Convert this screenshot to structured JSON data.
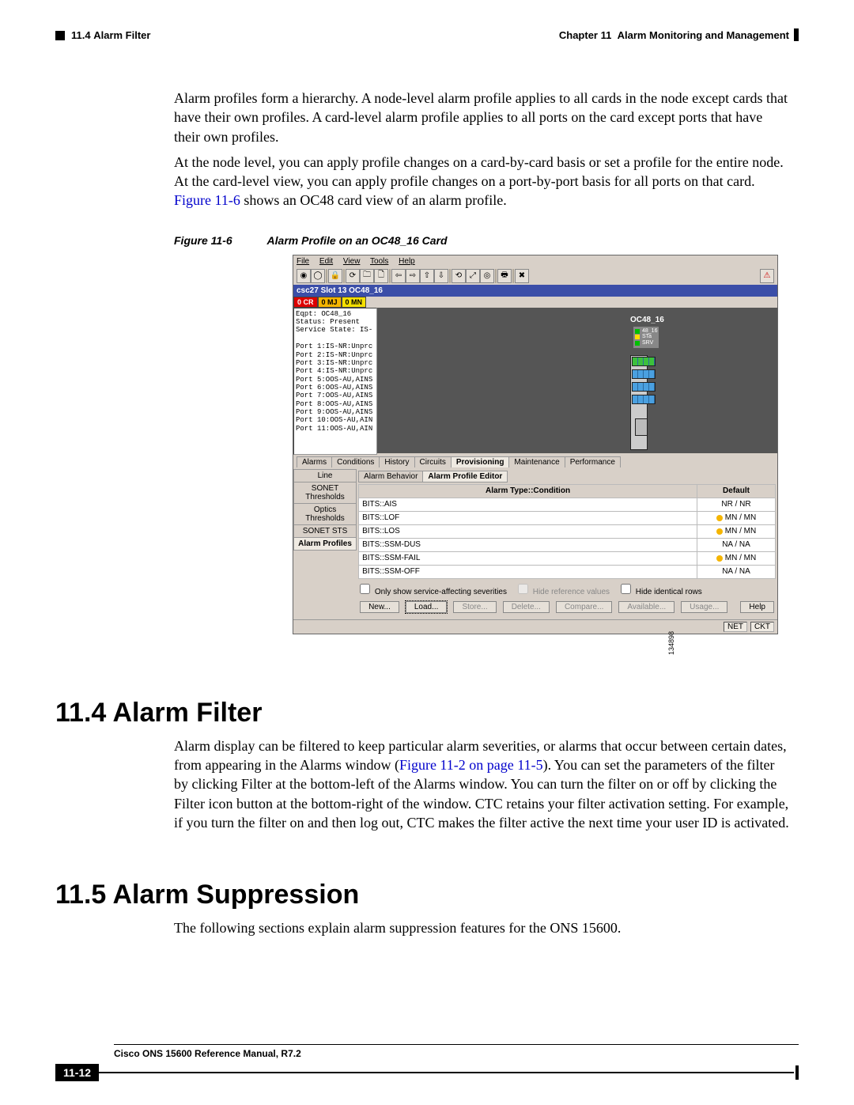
{
  "header": {
    "section_ref": "11.4",
    "section_title_small": "Alarm Filter",
    "chapter_label": "Chapter 11",
    "chapter_title": "Alarm Monitoring and Management"
  },
  "para1": "Alarm profiles form a hierarchy. A node-level alarm profile applies to all cards in the node except cards that have their own profiles. A card-level alarm profile applies to all ports on the card except ports that have their own profiles.",
  "para2a": "At the node level, you can apply profile changes on a card-by-card basis or set a profile for the entire node. At the card-level view, you can apply profile changes on a port-by-port basis for all ports on that card. ",
  "para2_link": "Figure 11-6",
  "para2b": " shows an OC48 card view of an alarm profile.",
  "figure": {
    "label": "Figure 11-6",
    "title": "Alarm Profile on an OC48_16 Card"
  },
  "shot": {
    "menus": [
      "File",
      "Edit",
      "View",
      "Tools",
      "Help"
    ],
    "title": "csc27 Slot 13 OC48_16",
    "counts": {
      "cr": "0 CR",
      "mj": "0 MJ",
      "mn": "0 MN"
    },
    "status_lines": [
      "Eqpt: OC48_16",
      "Status: Present",
      "Service State: IS-",
      "",
      "Port 1:IS-NR:Unprc",
      "Port 2:IS-NR:Unprc",
      "Port 3:IS-NR:Unprc",
      "Port 4:IS-NR:Unprc",
      "Port 5:OOS-AU,AINS",
      "Port 6:OOS-AU,AINS",
      "Port 7:OOS-AU,AINS",
      "Port 8:OOS-AU,AINS",
      "Port 9:OOS-AU,AINS",
      "Port 10:OOS-AU,AIN",
      "Port 11:OOS-AU,AIN"
    ],
    "card_label": "OC48_16",
    "legend": [
      {
        "color": "#00c000",
        "label": "48_16"
      },
      {
        "color": "#ffe000",
        "label": "STa"
      },
      {
        "color": "#00c000",
        "label": "SRV"
      }
    ],
    "top_tabs": [
      "Alarms",
      "Conditions",
      "History",
      "Circuits",
      "Provisioning",
      "Maintenance",
      "Performance"
    ],
    "top_tab_active": "Provisioning",
    "side_tabs": [
      "Line",
      "SONET Thresholds",
      "Optics Thresholds",
      "SONET STS",
      "Alarm Profiles"
    ],
    "side_tab_active": "Alarm Profiles",
    "sub_tabs": [
      "Alarm Behavior",
      "Alarm Profile Editor"
    ],
    "sub_tab_active": "Alarm Profile Editor",
    "grid_headers": [
      "Alarm Type::Condition",
      "Default"
    ],
    "grid_rows": [
      {
        "cond": "BITS::AIS",
        "def": "NR / NR",
        "dot": false
      },
      {
        "cond": "BITS::LOF",
        "def": "MN / MN",
        "dot": true
      },
      {
        "cond": "BITS::LOS",
        "def": "MN / MN",
        "dot": true
      },
      {
        "cond": "BITS::SSM-DUS",
        "def": "NA / NA",
        "dot": false
      },
      {
        "cond": "BITS::SSM-FAIL",
        "def": "MN / MN",
        "dot": true
      },
      {
        "cond": "BITS::SSM-OFF",
        "def": "NA / NA",
        "dot": false
      }
    ],
    "checks": {
      "only_sa": "Only show service-affecting severities",
      "hide_ref": "Hide reference values",
      "hide_ident": "Hide identical rows"
    },
    "buttons": {
      "new": "New...",
      "load": "Load...",
      "store": "Store...",
      "delete": "Delete...",
      "compare": "Compare...",
      "available": "Available...",
      "usage": "Usage...",
      "help": "Help"
    },
    "statusbar": {
      "net": "NET",
      "ckt": "CKT"
    },
    "image_id": "134898"
  },
  "section_114": {
    "heading": "11.4  Alarm Filter",
    "body_a": "Alarm display can be filtered to keep particular alarm severities, or alarms that occur between certain dates, from appearing in the Alarms window (",
    "link": "Figure 11-2 on page 11-5",
    "body_b": "). You can set the parameters of the filter by clicking Filter at the bottom-left of the Alarms window. You can turn the filter on or off by clicking the Filter icon button at the bottom-right of the window. CTC retains your filter activation setting. For example, if you turn the filter on and then log out, CTC makes the filter active the next time your user ID is activated."
  },
  "section_115": {
    "heading": "11.5  Alarm Suppression",
    "body": "The following sections explain alarm suppression features for the ONS 15600."
  },
  "footer": {
    "book": "Cisco ONS 15600 Reference Manual, R7.2",
    "page": "11-12"
  }
}
